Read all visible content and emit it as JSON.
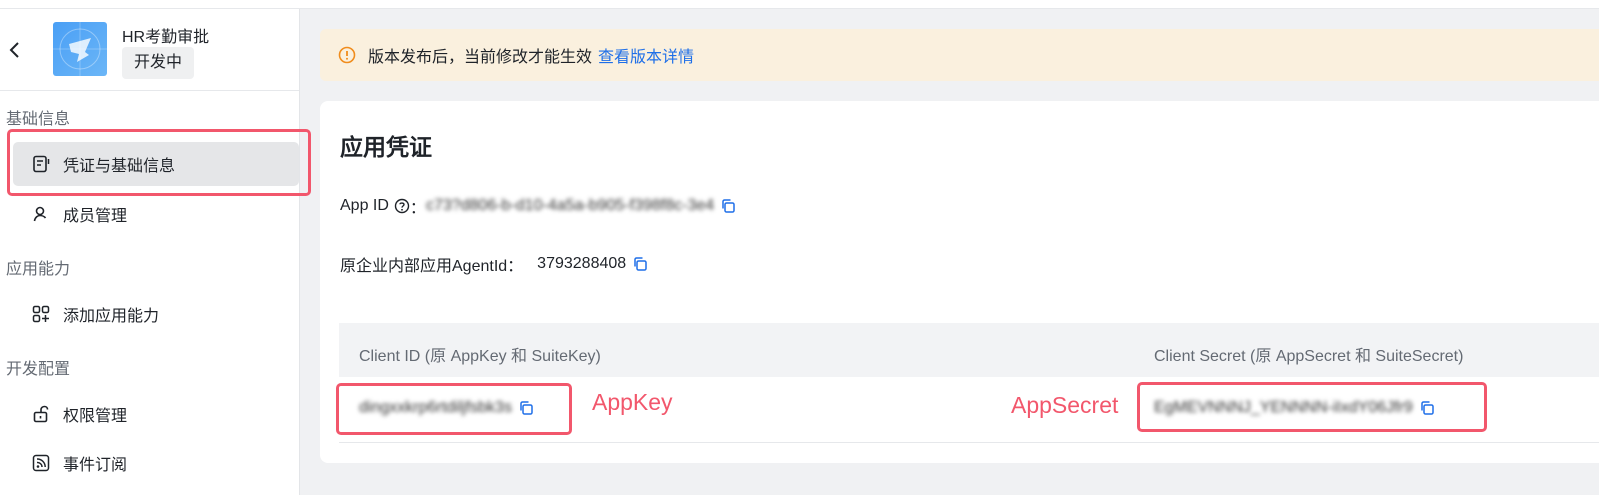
{
  "sidebar": {
    "app_name": "HR考勤审批",
    "app_status": "开发中",
    "groups": [
      {
        "title": "基础信息",
        "items": [
          {
            "label": "凭证与基础信息",
            "icon": "credential-icon"
          },
          {
            "label": "成员管理",
            "icon": "user-icon"
          }
        ]
      },
      {
        "title": "应用能力",
        "items": [
          {
            "label": "添加应用能力",
            "icon": "add-capability-icon"
          }
        ]
      },
      {
        "title": "开发配置",
        "items": [
          {
            "label": "权限管理",
            "icon": "lock-icon"
          },
          {
            "label": "事件订阅",
            "icon": "rss-icon"
          }
        ]
      }
    ]
  },
  "notice": {
    "text": "版本发布后，当前修改才能生效",
    "link": "查看版本详情"
  },
  "card": {
    "title": "应用凭证",
    "app_id_label": "App ID",
    "app_id_sep": "：",
    "app_id_value": "c73?d806-b-d10-4a5a-b905-f398f8c-3e4",
    "agent_label": "原企业内部应用AgentId：",
    "agent_value": "3793288408",
    "table": {
      "col1": "Client ID (原 AppKey 和 SuiteKey)",
      "col2": "Client Secret (原 AppSecret 和 SuiteSecret)",
      "client_id": "dingxxkrp6rtdiljfsbk3s",
      "client_secret": "EgMEVNNNJ_YENNNN-iIxdY06Jfr9"
    }
  },
  "annotations": {
    "appkey": "AppKey",
    "appsecret": "AppSecret",
    "color": "#f2576c"
  },
  "colors": {
    "link": "#1f6fe8",
    "notice_bg": "#faf0de",
    "notice_icon": "#f08c1c"
  }
}
